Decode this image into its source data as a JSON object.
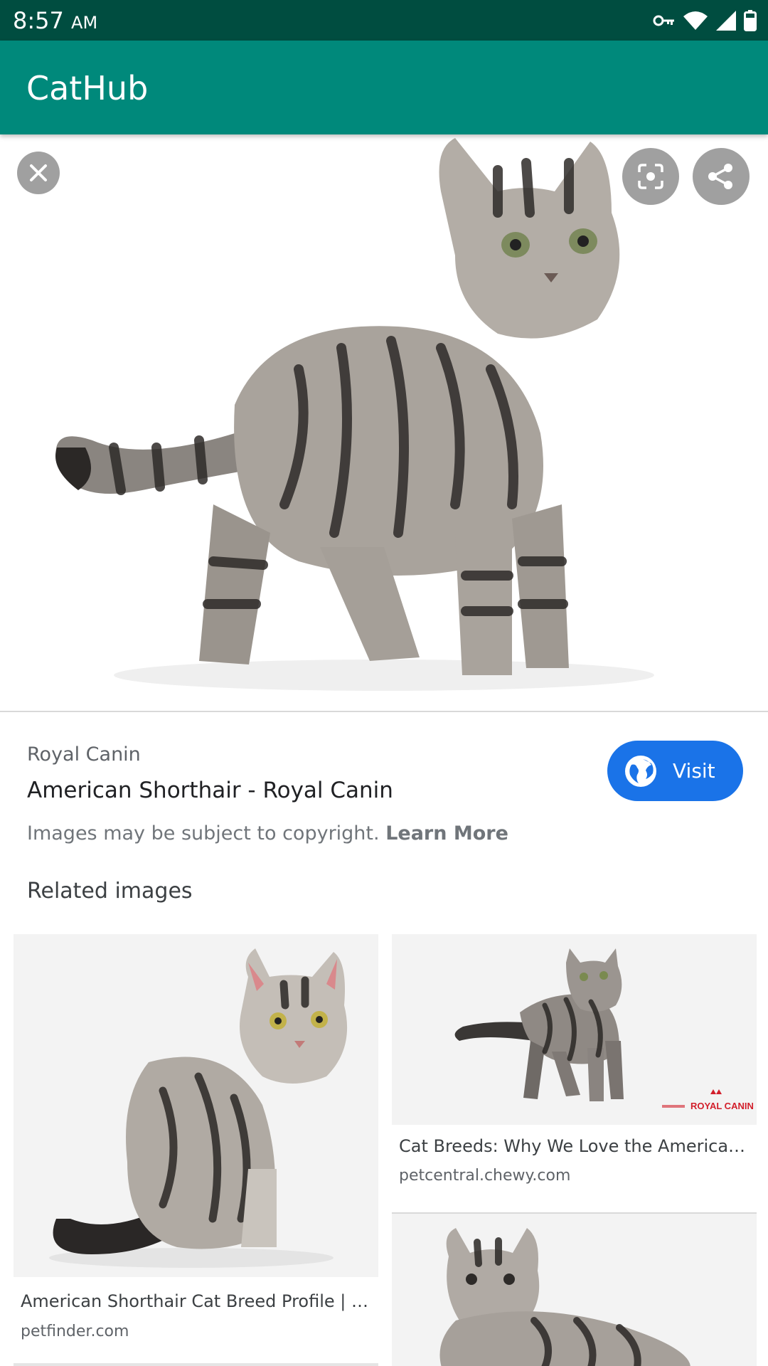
{
  "status_bar": {
    "time": "8:57",
    "ampm": "AM",
    "icons": [
      "vpn-key-icon",
      "wifi-icon",
      "signal-icon",
      "battery-icon"
    ]
  },
  "app_bar": {
    "title": "CatHub"
  },
  "viewer": {
    "close_icon": "close-icon",
    "lens_icon": "lens-icon",
    "share_icon": "share-icon"
  },
  "result": {
    "source": "Royal Canin",
    "title": "American Shorthair - Royal Canin",
    "copyright_text": "Images may be subject to copyright.",
    "learn_more": "Learn More",
    "visit_label": "Visit"
  },
  "related": {
    "heading": "Related images",
    "items": [
      {
        "caption": "American Shorthair Cat Breed Profile | Pet...",
        "domain": "petfinder.com"
      },
      {
        "caption": "Cat Breeds: Why We Love the American S...",
        "domain": "petcentral.chewy.com",
        "logo_text": "ROYAL CANIN"
      },
      {
        "caption": "",
        "domain": ""
      }
    ]
  },
  "colors": {
    "status_bar": "#004d40",
    "app_bar": "#00897b",
    "visit_button": "#1a73e8"
  }
}
